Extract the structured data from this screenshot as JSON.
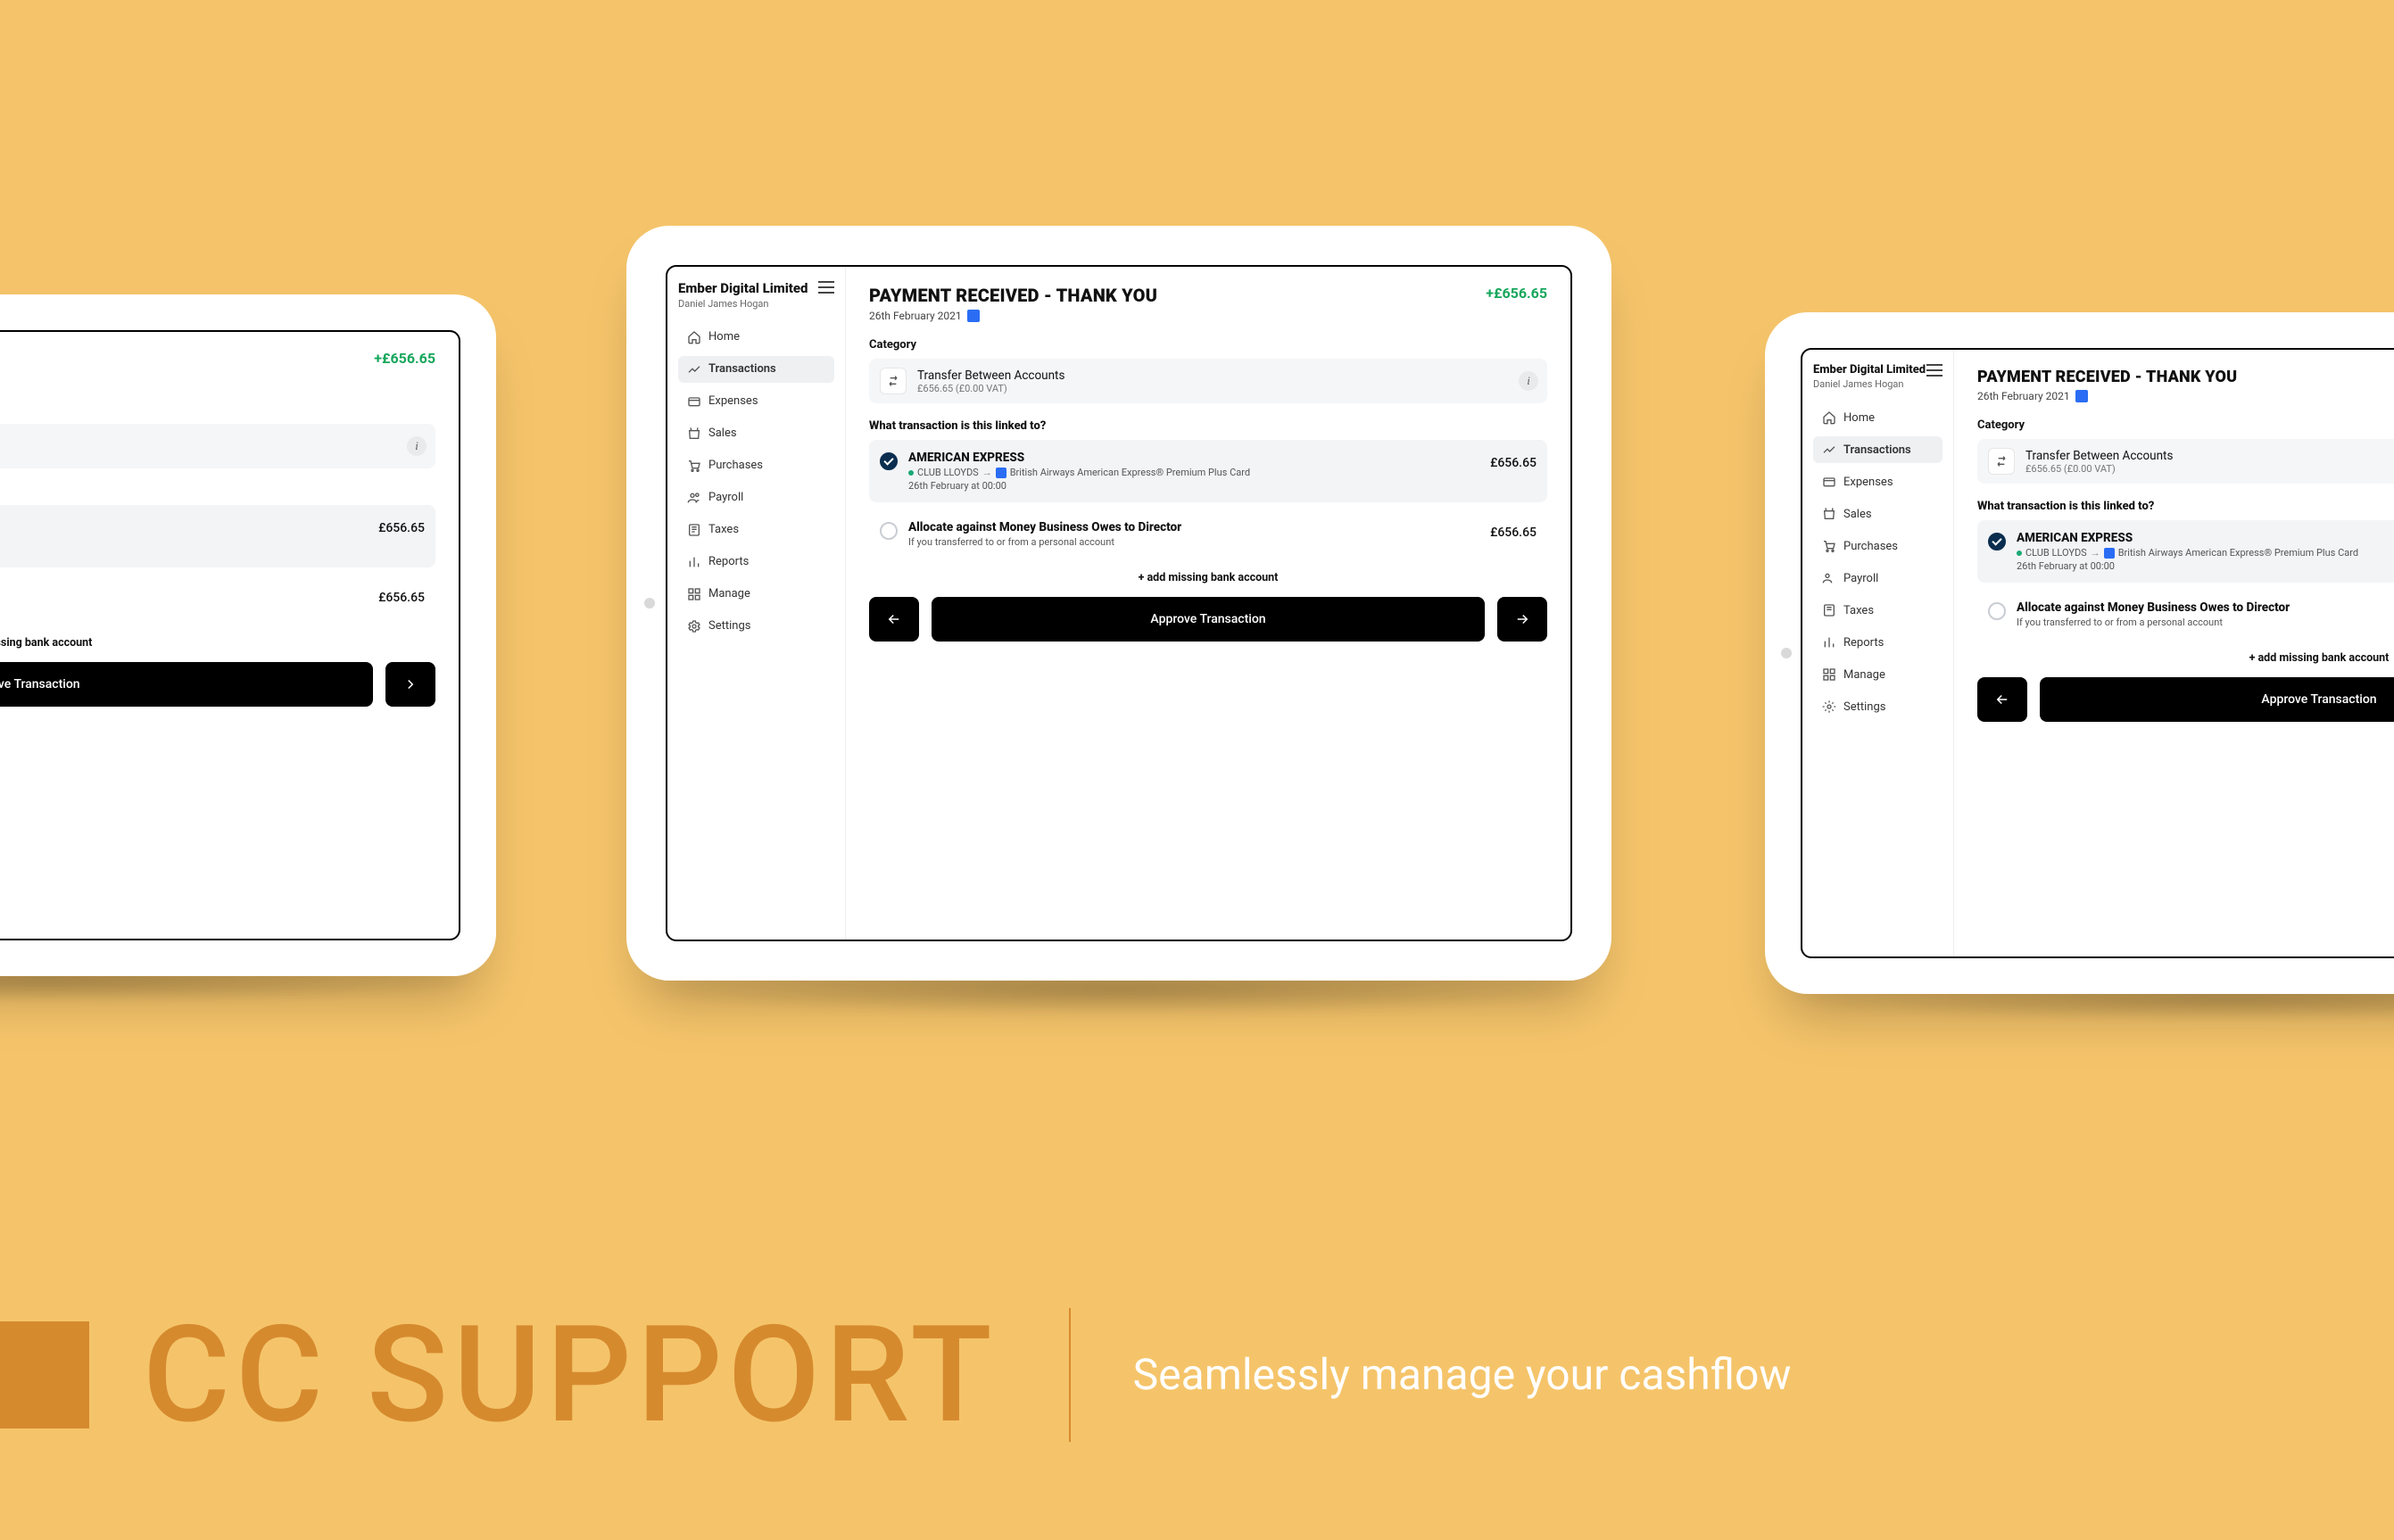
{
  "branding": {
    "cc_title": "CC SUPPORT",
    "tagline": "Seamlessly manage your cashflow"
  },
  "org": {
    "name": "Ember Digital Limited",
    "user": "Daniel James Hogan"
  },
  "nav": {
    "home": "Home",
    "transactions": "Transactions",
    "expenses": "Expenses",
    "sales": "Sales",
    "purchases": "Purchases",
    "payroll": "Payroll",
    "taxes": "Taxes",
    "reports": "Reports",
    "manage": "Manage",
    "settings": "Settings"
  },
  "txn": {
    "title": "PAYMENT RECEIVED - THANK YOU",
    "date": "26th February 2021",
    "amount": "+£656.65",
    "category_label": "Category",
    "category": {
      "name": "Transfer Between Accounts",
      "sub": "£656.65 (£0.00 VAT)"
    },
    "link_question": "What transaction is this linked to?",
    "options": [
      {
        "title": "AMERICAN EXPRESS",
        "route_from": "CLUB LLOYDS",
        "route_to": "British Airways American Express® Premium Plus Card",
        "date": "26th February at 00:00",
        "amount": "£656.65",
        "selected": true
      },
      {
        "title": "Allocate against Money Business Owes to Director",
        "sub": "If you transferred to or from a personal account",
        "amount": "£656.65",
        "selected": false
      }
    ],
    "add_missing": "+ add missing bank account",
    "approve": "Approve Transaction"
  }
}
